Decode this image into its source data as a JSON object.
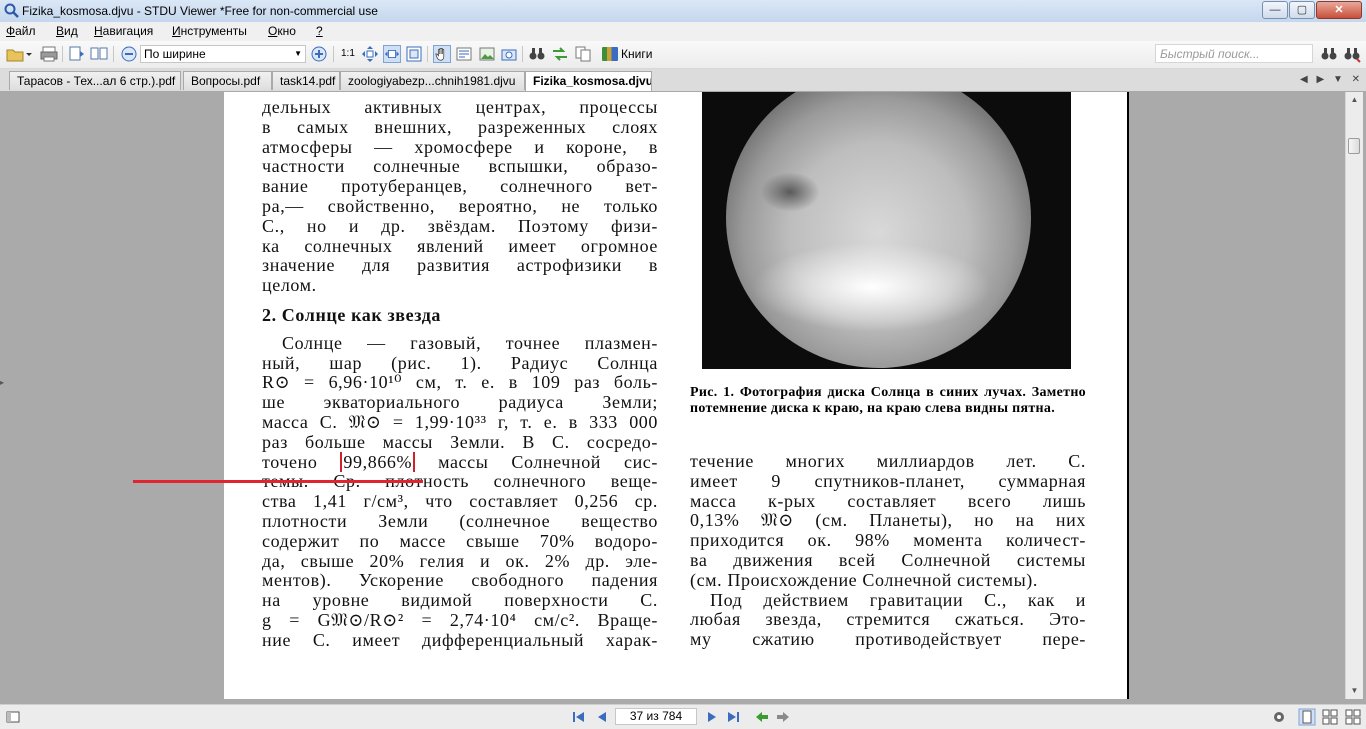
{
  "window": {
    "title": "Fizika_kosmosa.djvu - STDU Viewer *Free for non-commercial use",
    "min": "—",
    "max": "▢",
    "close": "✕"
  },
  "menu": [
    {
      "u": "Ф",
      "rest": "айл"
    },
    {
      "u": "В",
      "rest": "ид"
    },
    {
      "u": "Н",
      "rest": "авигация"
    },
    {
      "u": "И",
      "rest": "нструменты"
    },
    {
      "u": "О",
      "rest": "кно"
    },
    {
      "u": "?",
      "rest": ""
    }
  ],
  "toolbar": {
    "zoom_mode": "По ширине",
    "actual_size": "1:1",
    "books": "Книги",
    "search_placeholder": "Быстрый поиск..."
  },
  "tabs": [
    "Тарасов - Тех...ал 6 стр.).pdf",
    "Вопросы.pdf",
    "task14.pdf",
    "zoologiyabezp...chnih1981.djvu",
    "Fizika_kosmosa.djvu"
  ],
  "document": {
    "left_lines": [
      "дельных активных центрах, процессы",
      "в самых внешних, разреженных слоях",
      "атмосферы — хромосфере и короне, в",
      "частности солнечные вспышки, образо-",
      "вание протуберанцев, солнечного вет-",
      "ра,— свойственно, вероятно, не только",
      "С., но и др. звёздам. Поэтому физи-",
      "ка солнечных явлений имеет огромное",
      "значение для развития астрофизики в",
      "целом."
    ],
    "heading": "2. Солнце как звезда",
    "left_lines_2a": [
      "Солнце — газовый, точнее плазмен-",
      "ный, шар (рис. 1). Радиус Солнца",
      "R⊙ = 6,96·10¹⁰ см, т. е. в 109 раз боль-",
      "ше экваториального радиуса Земли;",
      "масса С. 𝔐⊙ = 1,99·10³³ г, т. е. в 333 000",
      "раз больше массы Земли. В С. сосредо-"
    ],
    "marked_line_pre": "точено",
    "marked_value": "99,866%",
    "marked_line_post": "массы Солнечной сис-",
    "left_lines_2b": [
      "темы. Ср. плотность солнечного веще-",
      "ства 1,41 г/см³, что составляет 0,256 ср.",
      "плотности Земли (солнечное вещество",
      "содержит по массе свыше 70% водоро-",
      "да, свыше 20% гелия и ок. 2% др. эле-",
      "ментов). Ускорение свободного падения",
      "на уровне видимой поверхности С.",
      "g = G𝔐⊙/R⊙² = 2,74·10⁴ см/с². Враще-",
      "ние С. имеет дифференциальный харак-"
    ],
    "caption": "Рис. 1. Фотография диска Солнца в синих лучах. Заметно потемнение диска к краю, на краю слева видны пятна.",
    "right_lines": [
      "течение многих миллиардов лет. С.",
      "имеет 9 спутников-планет, суммарная",
      "масса к-рых составляет всего лишь",
      "0,13% 𝔐⊙ (см. Планеты), но на них",
      "приходится ок. 98% момента количест-",
      "ва движения всей Солнечной системы",
      "(см. Происхождение Солнечной системы).",
      "Под действием гравитации С., как и",
      "любая звезда, стремится сжаться. Это-",
      "му сжатию противодействует пере-"
    ]
  },
  "status": {
    "page_indicator": "37 из 784"
  },
  "colors": {
    "annotation_red": "#e02430",
    "active_tab_bg": "#ffffff"
  }
}
